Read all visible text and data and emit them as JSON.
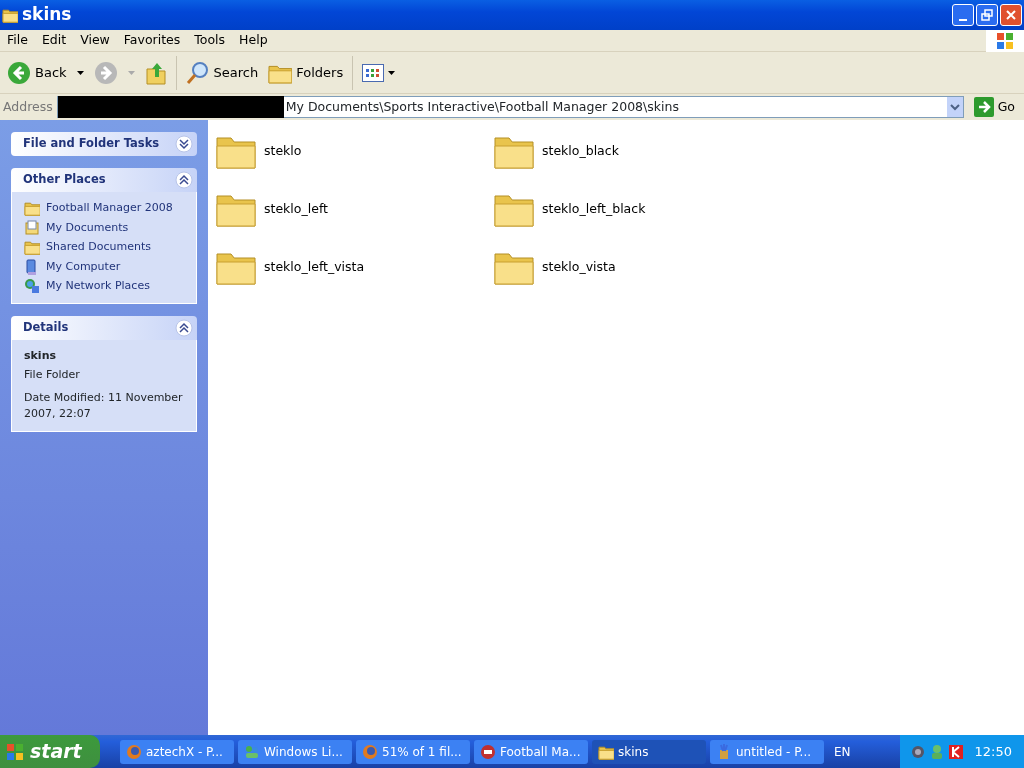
{
  "window": {
    "title": "skins"
  },
  "menu": [
    "File",
    "Edit",
    "View",
    "Favorites",
    "Tools",
    "Help"
  ],
  "toolbar": [
    {
      "kind": "back",
      "label": "Back",
      "disabled": false
    },
    {
      "kind": "forward",
      "disabled": true
    },
    {
      "kind": "up"
    },
    {
      "kind": "search",
      "label": "Search"
    },
    {
      "kind": "folders",
      "label": "Folders"
    },
    {
      "kind": "views"
    }
  ],
  "address": {
    "label": "Address",
    "value": "My Documents\\Sports Interactive\\Football Manager 2008\\skins",
    "go": "Go"
  },
  "panels": [
    {
      "kind": "tasks",
      "title": "File and Folder Tasks",
      "expanded": false
    },
    {
      "kind": "places",
      "title": "Other Places",
      "expanded": true,
      "items": [
        {
          "label": "Football Manager 2008",
          "kind": "folder"
        },
        {
          "label": "My Documents",
          "kind": "documents"
        },
        {
          "label": "Shared Documents",
          "kind": "folder"
        },
        {
          "label": "My Computer",
          "kind": "computer"
        },
        {
          "label": "My Network Places",
          "kind": "network"
        }
      ]
    },
    {
      "kind": "details",
      "title": "Details",
      "expanded": true,
      "name": "skins",
      "type": "File Folder",
      "modified": "Date Modified: 11 November 2007, 22:07"
    }
  ],
  "folders": [
    "steklo",
    "steklo_black",
    "steklo_left",
    "steklo_left_black",
    "steklo_left_vista",
    "steklo_vista"
  ],
  "taskbar": {
    "start": "start",
    "tasks": [
      {
        "label": "aztechX - P...",
        "kind": "browser",
        "selected": false
      },
      {
        "label": "Windows Li...",
        "kind": "messenger",
        "selected": false
      },
      {
        "label": "51% of 1 fil...",
        "kind": "browser",
        "selected": false
      },
      {
        "label": "Football Ma...",
        "kind": "game",
        "selected": false
      },
      {
        "label": "skins",
        "kind": "folder",
        "selected": true
      },
      {
        "label": "untitled - P...",
        "kind": "paint",
        "selected": false
      }
    ],
    "language": "EN",
    "clock": "12:50"
  }
}
